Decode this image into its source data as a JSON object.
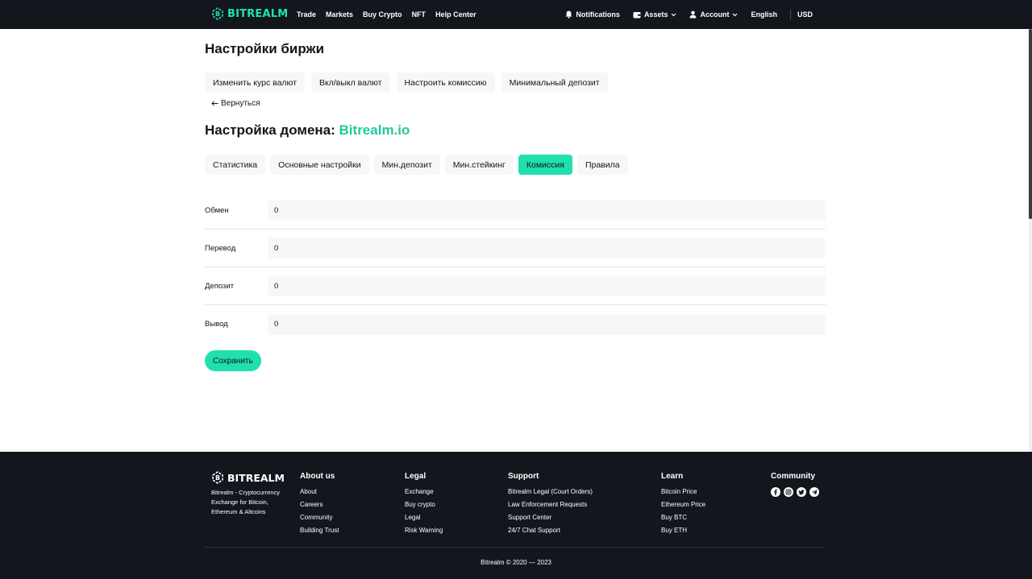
{
  "brand": {
    "name": "BITREALM",
    "accent": "#1ee3b0",
    "dark_bg": "#14161d"
  },
  "topnav": {
    "links": [
      "Trade",
      "Markets",
      "Buy Crypto",
      "NFT",
      "Help Center"
    ],
    "notifications": "Notifications",
    "assets": "Assets",
    "account": "Account",
    "language": "English",
    "currency": "USD"
  },
  "page": {
    "title": "Настройки биржи",
    "top_tabs": [
      "Изменить курс валют",
      "Вкл/выкл валют",
      "Настроить комиссию",
      "Минимальный депозит"
    ],
    "back_label": "Вернуться",
    "domain_title_prefix": "Настройка домена:",
    "domain_name": "Bitrealm.io",
    "sub_tabs": [
      "Статистика",
      "Основные настройки",
      "Мин.депозит",
      "Мин.стейкинг",
      "Комиссия",
      "Правила"
    ],
    "active_sub_tab": "Комиссия",
    "fields": [
      {
        "label": "Обмен",
        "value": "0"
      },
      {
        "label": "Перевод",
        "value": "0"
      },
      {
        "label": "Депозит",
        "value": "0"
      },
      {
        "label": "Вывод",
        "value": "0"
      }
    ],
    "save_label": "Сохранить"
  },
  "footer": {
    "logo": "BITREALM",
    "tagline": "Bitrealm - Cryptocurrency Exchange for Bitcoin, Ethereum & Altcoins",
    "columns": [
      {
        "title": "About us",
        "links": [
          "About",
          "Careers",
          "Community",
          "Building Trust"
        ]
      },
      {
        "title": "Legal",
        "links": [
          "Exchange",
          "Buy crypto",
          "Legal",
          "Risk Warning"
        ]
      },
      {
        "title": "Support",
        "links": [
          "Bitrealm Legal (Court Orders)",
          "Law Enforcement Requests",
          "Support Center",
          "24/7 Chat Support"
        ]
      },
      {
        "title": "Learn",
        "links": [
          "Bitcoin Price",
          "Ethereum Price",
          "Buy BTC",
          "Buy ETH"
        ]
      }
    ],
    "community_title": "Community",
    "social_icons": [
      "facebook-icon",
      "instagram-icon",
      "twitter-icon",
      "telegram-icon"
    ],
    "copyright": "Bitrealm © 2020 — 2023"
  }
}
